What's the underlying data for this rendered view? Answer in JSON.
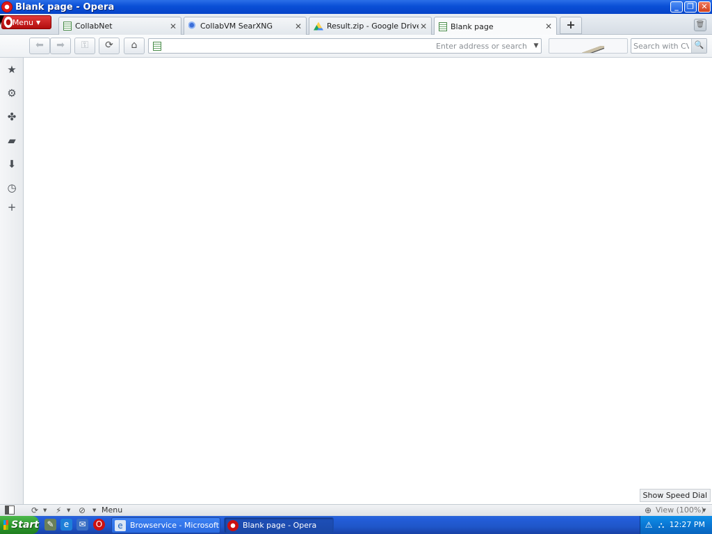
{
  "window": {
    "title": "Blank page - Opera",
    "controls": [
      "minimize-icon",
      "restore-icon",
      "close-icon"
    ]
  },
  "menu_button": {
    "label": "Menu"
  },
  "tabs": [
    {
      "label": "CollabNet",
      "icon": "page-icon",
      "active": false
    },
    {
      "label": "CollabVM SearXNG",
      "icon": "puzzle-icon",
      "active": false
    },
    {
      "label": "Result.zip - Google Drive",
      "icon": "google-drive-icon",
      "active": false
    },
    {
      "label": "Blank page",
      "icon": "page-icon",
      "active": true
    }
  ],
  "tab_close_glyph": "✕",
  "navigation": {
    "address": {
      "value": "",
      "placeholder": "Enter address or search"
    },
    "search": {
      "value": "",
      "placeholder": "Search with CVM"
    }
  },
  "side_panel": {
    "items": [
      "bookmarks-icon",
      "extensions-icon",
      "unite-icon",
      "notes-icon",
      "downloads-icon",
      "history-icon",
      "add-panel-icon"
    ]
  },
  "tooltip": {
    "text": "Show Speed Dial"
  },
  "status_bar": {
    "menu_label": "Menu",
    "zoom": "View (100%)"
  },
  "taskbar": {
    "start_label": "Start",
    "tasks": [
      {
        "label": "Browservice - Microsoft ...",
        "active": false
      },
      {
        "label": "Blank page - Opera",
        "active": true
      }
    ],
    "clock": "12:27 PM"
  },
  "colors": {
    "titlebar": "#0a4fd6",
    "opera_red": "#cc1111",
    "taskbar": "#245edb",
    "start_green": "#2f9a2f"
  }
}
